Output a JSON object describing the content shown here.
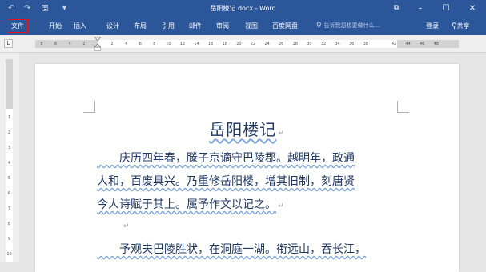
{
  "window": {
    "title": "岳阳楼记.docx - Word",
    "quick_access": {
      "undo": "↶",
      "redo": "↷",
      "save": "🖫",
      "customize": "▾"
    },
    "controls": {
      "restore_ribbon": "⧉",
      "minimize": "–",
      "maximize": "☐",
      "close": "✕"
    }
  },
  "ribbon": {
    "tabs": [
      "文件",
      "开始",
      "插入",
      "设计",
      "布局",
      "引用",
      "邮件",
      "审阅",
      "视图",
      "百度网盘"
    ],
    "tell_me_placeholder": "告诉我您想要做什么...",
    "tell_me_icon": "lightbulb-icon",
    "sign_in": "登录",
    "share": "共享",
    "share_icon": "person-icon"
  },
  "ruler": {
    "tab_selector": "L",
    "horizontal_numbers": [
      "8",
      "6",
      "4",
      "2",
      "",
      "2",
      "4",
      "6",
      "8",
      "10",
      "12",
      "14",
      "16",
      "18",
      "20",
      "22",
      "24",
      "26",
      "28",
      "30",
      "32",
      "34",
      "36",
      "38",
      "",
      "42",
      "44",
      "46",
      "48"
    ],
    "vertical_numbers": [
      "1",
      "2",
      "3",
      "4",
      "5",
      "6",
      "7",
      "8",
      "9",
      "10"
    ]
  },
  "document": {
    "title": "岳阳楼记",
    "title_mark": "↵",
    "lines": [
      "　　庆历四年春，滕子京谪守巴陵郡。越明年，政通",
      "人和，百废具兴。乃重修岳阳楼，增其旧制，刻唐贤",
      "今人诗赋于其上。属予作文以记之。",
      "　　予观夫巴陵胜状，在洞庭一湖。衔远山，吞长江，"
    ],
    "line3_mark": "↵",
    "empty_paragraph_mark": "↵"
  },
  "colors": {
    "brand_blue": "#2b579a",
    "text": "#1f3864",
    "file_tab_highlight": "#e81123"
  }
}
